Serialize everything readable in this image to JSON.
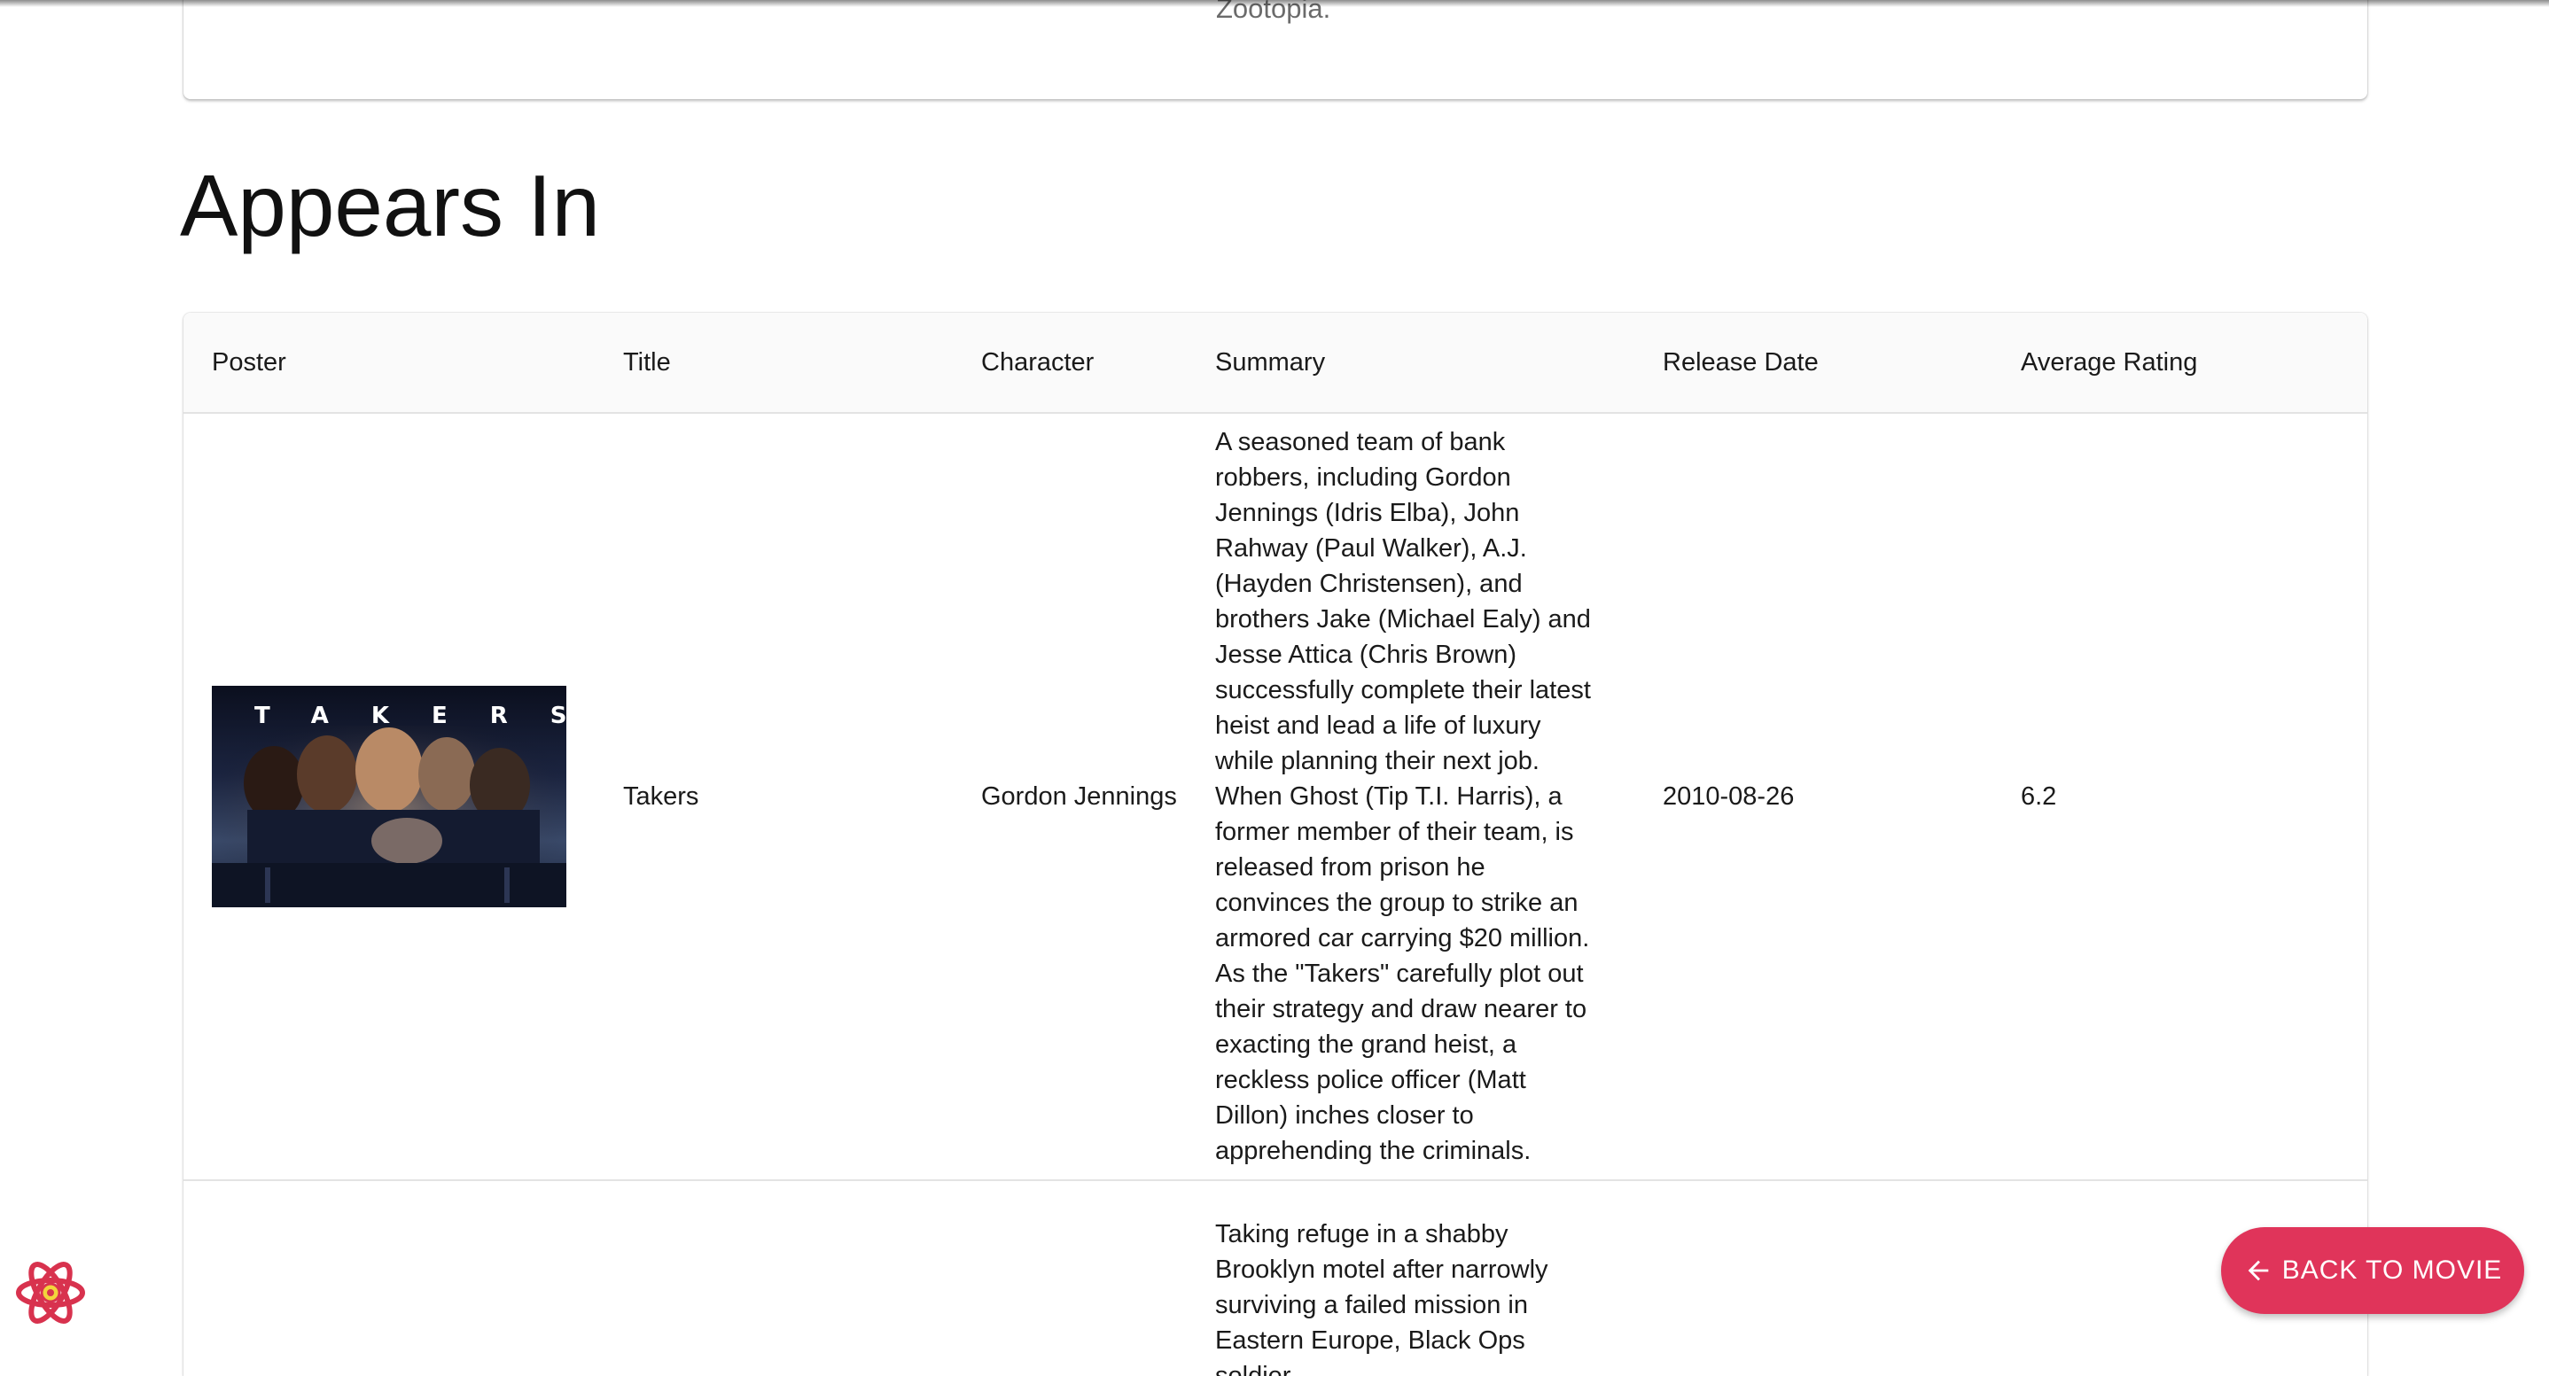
{
  "bio": {
    "text_tail": "Zootopia."
  },
  "section": {
    "title": "Appears In"
  },
  "table": {
    "headers": [
      "Poster",
      "Title",
      "Character",
      "Summary",
      "Release Date",
      "Average Rating"
    ],
    "rows": [
      {
        "poster_text": "TAKERS",
        "title": "Takers",
        "character": "Gordon Jennings",
        "summary": "A seasoned team of bank robbers, including Gordon Jennings (Idris Elba), John Rahway (Paul Walker), A.J. (Hayden Christensen), and brothers Jake (Michael Ealy) and Jesse Attica (Chris Brown) successfully complete their latest heist and lead a life of luxury while planning their next job. When Ghost (Tip T.I. Harris), a former member of their team, is released from prison he convinces the group to strike an armored car carrying $20 million. As the \"Takers\" carefully plot out their strategy and draw nearer to exacting the grand heist, a reckless police officer (Matt Dillon) inches closer to apprehending the criminals.",
        "release_date": "2010-08-26",
        "rating": "6.2"
      },
      {
        "summary": "Taking refuge in a shabby Brooklyn motel after narrowly surviving a failed mission in Eastern Europe, Black Ops soldier"
      }
    ]
  },
  "fab": {
    "label": "BACK TO MOVIE",
    "icon": "arrow-left-icon",
    "color": "#e0345a"
  },
  "devtools": {
    "icon": "react-icon"
  }
}
